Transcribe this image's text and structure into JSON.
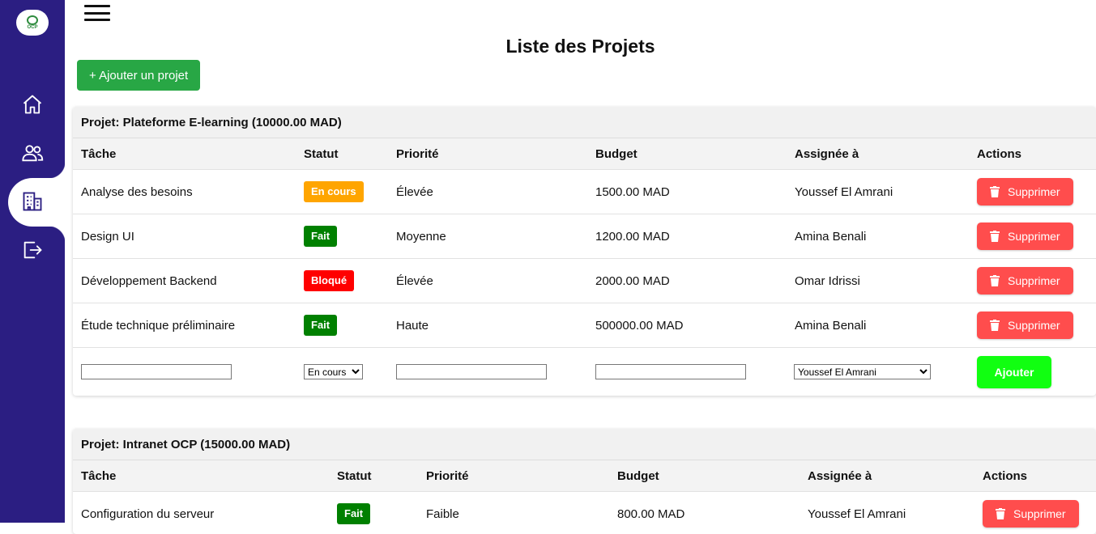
{
  "sidebar": {
    "logo_text": "OCP",
    "items": [
      {
        "icon": "home-icon"
      },
      {
        "icon": "users-icon"
      },
      {
        "icon": "building-icon"
      },
      {
        "icon": "logout-icon"
      }
    ]
  },
  "page": {
    "title": "Liste des Projets",
    "add_project_label": "+ Ajouter un projet"
  },
  "columns": [
    "Tâche",
    "Statut",
    "Priorité",
    "Budget",
    "Assignée à",
    "Actions"
  ],
  "projects": [
    {
      "header": "Projet: Plateforme E-learning (10000.00 MAD)",
      "tasks": [
        {
          "name": "Analyse des besoins",
          "status": "En cours",
          "status_color": "#ffa500",
          "priority": "Élevée",
          "budget": "1500.00 MAD",
          "assignee": "Youssef El Amrani",
          "action": "Supprimer"
        },
        {
          "name": "Design UI",
          "status": "Fait",
          "status_color": "#008000",
          "priority": "Moyenne",
          "budget": "1200.00 MAD",
          "assignee": "Amina Benali",
          "action": "Supprimer"
        },
        {
          "name": "Développement Backend",
          "status": "Bloqué",
          "status_color": "#ff0000",
          "priority": "Élevée",
          "budget": "2000.00 MAD",
          "assignee": "Omar Idrissi",
          "action": "Supprimer"
        },
        {
          "name": "Étude technique préliminaire",
          "status": "Fait",
          "status_color": "#008000",
          "priority": "Haute",
          "budget": "500000.00 MAD",
          "assignee": "Amina Benali",
          "action": "Supprimer"
        }
      ],
      "form": {
        "task_value": "",
        "status_selected": "En cours",
        "priority_value": "",
        "budget_value": "",
        "assignee_selected": "Youssef El Amrani",
        "submit_label": "Ajouter"
      }
    },
    {
      "header": "Projet: Intranet OCP (15000.00 MAD)",
      "tasks": [
        {
          "name": "Configuration du serveur",
          "status": "Fait",
          "status_color": "#008000",
          "priority": "Faible",
          "budget": "800.00 MAD",
          "assignee": "Youssef El Amrani",
          "action": "Supprimer"
        }
      ]
    }
  ]
}
